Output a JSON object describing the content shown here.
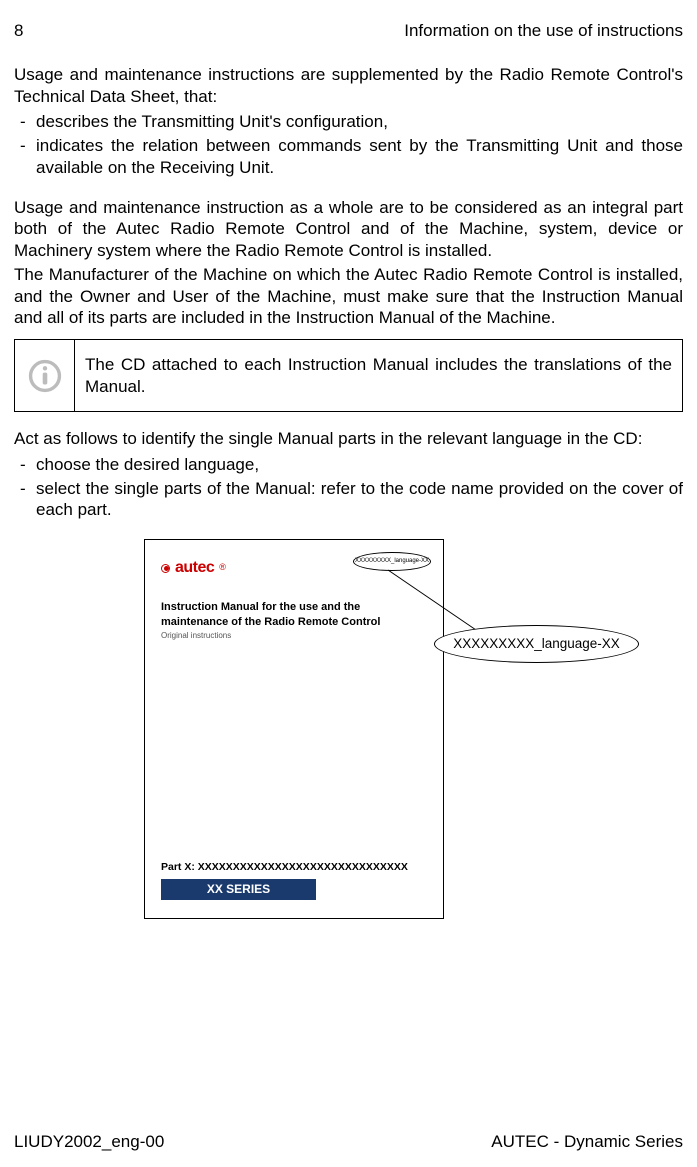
{
  "header": {
    "pageNumber": "8",
    "sectionTitle": "Information on the use of instructions"
  },
  "intro": {
    "lead": "Usage and maintenance instructions are supplemented by the Radio Remote Control's Technical Data Sheet, that:",
    "bullets": [
      "describes the Transmitting Unit's configuration,",
      "indicates the relation between commands sent by the Transmitting Unit and those available on the Receiving Unit."
    ]
  },
  "para_block": {
    "p1": "Usage and maintenance instruction as a whole are to be considered as an integral part both of the Autec Radio Remote Control and of the Machine, system, device or Machinery system where the Radio Remote Control is installed.",
    "p2": "The Manufacturer of the Machine on which the Autec Radio Remote Control is installed, and the Owner and User of the Machine, must make sure that the Instruction Manual and all of its parts are included in the Instruction Manual of the Machine."
  },
  "info_box": "The CD attached to each Instruction Manual includes the translations of the Manual.",
  "cd_section": {
    "lead": "Act as follows to identify the single Manual parts in the relevant language in the CD:",
    "bullets": [
      "choose the desired language,",
      "select the single parts of the Manual: refer to the code name provided on the cover of each part."
    ]
  },
  "cover": {
    "logo_text": "autec",
    "small_bubble": "XXXXXXXXX_language-XX",
    "title_line1": "Instruction Manual for the use and the",
    "title_line2": "maintenance of the Radio Remote Control",
    "orig": "Original instructions",
    "partx": "Part X: XXXXXXXXXXXXXXXXXXXXXXXXXXXXXX",
    "series": "XX SERIES",
    "big_bubble": "XXXXXXXXX_language-XX"
  },
  "footer": {
    "left": "LIUDY2002_eng-00",
    "right": "AUTEC - Dynamic Series"
  }
}
